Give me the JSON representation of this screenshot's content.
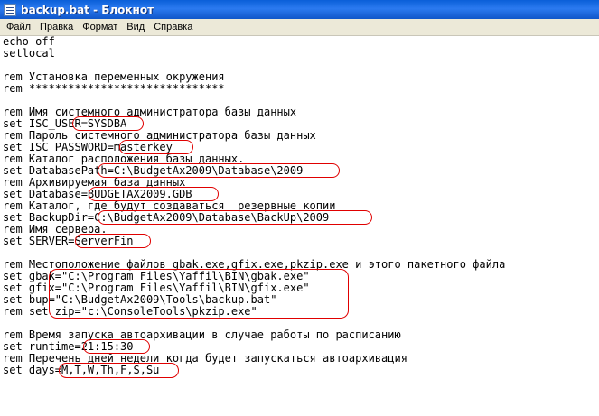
{
  "window": {
    "title": "backup.bat - Блокнот",
    "icon": "notepad-icon"
  },
  "menu": [
    {
      "label": "Файл",
      "name": "menu-file"
    },
    {
      "label": "Правка",
      "name": "menu-edit"
    },
    {
      "label": "Формат",
      "name": "menu-format"
    },
    {
      "label": "Вид",
      "name": "menu-view"
    },
    {
      "label": "Справка",
      "name": "menu-help"
    }
  ],
  "editor": {
    "lines": [
      "echo off",
      "setlocal",
      "",
      "rem Установка переменных окружения",
      "rem ******************************",
      "",
      "rem Имя системного администратора базы данных",
      "set ISC_USER=SYSDBA",
      "rem Пароль системного администратора базы данных",
      "set ISC_PASSWORD=masterkey",
      "rem Каталог расположения базы данных.",
      "set DatabasePath=C:\\BudgetAx2009\\Database\\2009",
      "rem Архивируемая база данных",
      "set Database=BUDGETAX2009.GDB",
      "rem Каталог, где будут создаваться  резервные копии",
      "set BackupDir=C:\\BudgetAx2009\\Database\\BackUp\\2009",
      "rem Имя сервера.",
      "set SERVER=ServerFin",
      "",
      "rem Местоположение файлов gbak.exe,gfix.exe,pkzip.exe и этого пакетного файла",
      "set gbak=\"C:\\Program Files\\Yaffil\\BIN\\gbak.exe\"",
      "set gfix=\"C:\\Program Files\\Yaffil\\BIN\\gfix.exe\"",
      "set bup=\"C:\\BudgetAx2009\\Tools\\backup.bat\"",
      "rem set zip=\"c:\\ConsoleTools\\pkzip.exe\"",
      "",
      "rem Время запуска автоархивации в случае работы по расписанию",
      "set runtime=21:15:30",
      "rem Перечень дней недели когда будет запускаться автоархивация",
      "set days=M,T,W,Th,F,S,Su"
    ]
  },
  "accent_colors": {
    "highlight_border": "#e00000",
    "titlebar": "#0a5fd8"
  }
}
